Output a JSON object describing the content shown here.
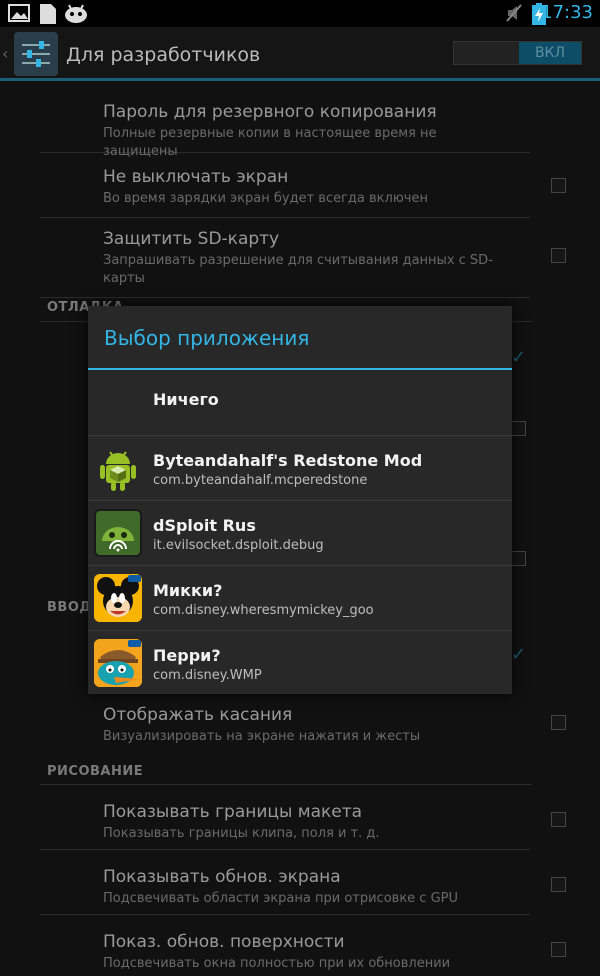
{
  "status_bar": {
    "time": "17:33",
    "left_icons": [
      "image-icon",
      "sd-card-icon",
      "android-icon"
    ],
    "right_icons": [
      "mute-icon",
      "battery-charging-icon"
    ]
  },
  "action_bar": {
    "title": "Для разработчиков",
    "toggle_label": "ВКЛ",
    "toggle_on": true
  },
  "settings": {
    "backup_password": {
      "title": "Пароль для резервного копирования",
      "subtitle": "Полные резервные копии в настоящее время не защищены"
    },
    "stay_awake": {
      "title": "Не выключать экран",
      "subtitle": "Во время зарядки экран будет всегда включен",
      "checked": false
    },
    "protect_sd": {
      "title": "Защитить SD-карту",
      "subtitle": "Запрашивать разрешение для считывания данных с SD-карты",
      "checked": false
    },
    "section_debug": "ОТЛАДКА",
    "section_input": "ВВОД",
    "show_touches": {
      "title": "Отображать касания",
      "subtitle": "Визуализировать на экране нажатия и жесты",
      "checked": false
    },
    "section_drawing": "РИСОВАНИЕ",
    "layout_bounds": {
      "title": "Показывать границы макета",
      "subtitle": "Показывать границы клипа, поля и т. д.",
      "checked": false
    },
    "gpu_updates": {
      "title": "Показывать обнов. экрана",
      "subtitle": "Подсвечивать области экрана при отрисовке с GPU",
      "checked": false
    },
    "surface_updates": {
      "title": "Показ. обнов. поверхности",
      "subtitle": "Подсвечивать окна полностью при их обновлении",
      "checked": false
    }
  },
  "dialog": {
    "title": "Выбор приложения",
    "items": [
      {
        "name": "Ничего",
        "package": ""
      },
      {
        "name": "Byteandahalf's Redstone Mod",
        "package": "com.byteandahalf.mcperedstone",
        "icon": "android-box-icon"
      },
      {
        "name": "dSploit Rus",
        "package": "it.evilsocket.dsploit.debug",
        "icon": "dsploit-icon"
      },
      {
        "name": "Микки?",
        "package": "com.disney.wheresmymickey_goo",
        "icon": "mickey-icon"
      },
      {
        "name": "Перри?",
        "package": "com.disney.WMP",
        "icon": "perry-icon"
      }
    ]
  },
  "colors": {
    "accent": "#33b5e5",
    "dialog_bg": "#282828"
  }
}
